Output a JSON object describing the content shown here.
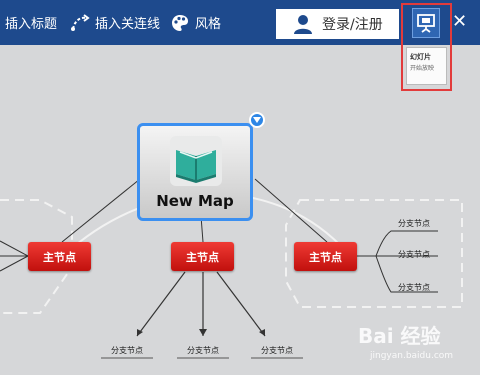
{
  "toolbar": {
    "insert_title_label": "插入标题",
    "insert_relation_label": "插入关连线",
    "style_label": "风格",
    "login_label": "登录/注册",
    "close_label": "✕"
  },
  "tooltip": {
    "title": "幻灯片",
    "subtitle": "开始放映"
  },
  "map": {
    "central_title": "New Map",
    "main_nodes": [
      "主节点",
      "主节点",
      "主节点"
    ],
    "bottom_leaves": [
      "分支节点",
      "分支节点",
      "分支节点"
    ],
    "right_leaves": [
      "分支节点",
      "分支节点",
      "分支节点"
    ]
  },
  "watermark": {
    "text": "Bai 经验",
    "sub": "jingyan.baidu.com"
  },
  "colors": {
    "toolbar_bg": "#1e4a8d",
    "node_red": "#d8201c",
    "selection_blue": "#3b8ff0",
    "highlight_red": "#e23b3b"
  }
}
